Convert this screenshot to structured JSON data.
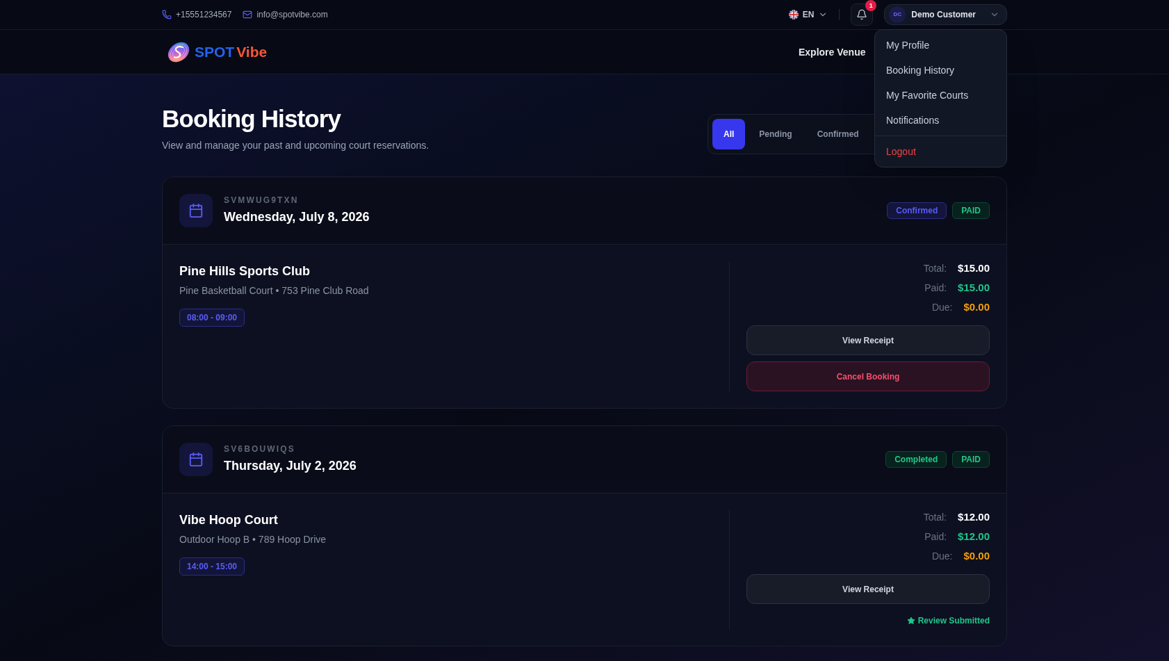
{
  "top_bar": {
    "phone": "+15551234567",
    "email": "info@spotvibe.com",
    "language": "EN",
    "notification_count": "1",
    "user": {
      "initials": "DC",
      "name": "Demo Customer",
      "menu_open": true
    }
  },
  "user_menu": [
    {
      "label": "My Profile",
      "kind": "item"
    },
    {
      "label": "Booking History",
      "kind": "item"
    },
    {
      "label": "My Favorite Courts",
      "kind": "item"
    },
    {
      "label": "Notifications",
      "kind": "item"
    },
    {
      "label": "Logout",
      "kind": "danger"
    }
  ],
  "logo": {
    "primary": "SPOT",
    "accent": "Vibe"
  },
  "nav_links": [
    "Explore Venue"
  ],
  "page": {
    "title": "Booking History",
    "subtitle": "View and manage your past and upcoming court reservations."
  },
  "filter_tabs": [
    {
      "label": "All",
      "selected": true
    },
    {
      "label": "Pending",
      "selected": false
    },
    {
      "label": "Confirmed",
      "selected": false
    }
  ],
  "bookings": [
    {
      "code": "SVMWUG9TXN",
      "date": "Wednesday, July 8, 2026",
      "status": {
        "label": "Confirmed",
        "kind": "confirmed"
      },
      "payment": {
        "label": "PAID",
        "kind": "paid"
      },
      "venue": "Pine Hills Sports Club",
      "details": "Pine Basketball Court • 753 Pine Club Road",
      "time": "08:00 - 09:00",
      "amounts": [
        {
          "label": "Total:",
          "value": "$15.00",
          "kind": "total"
        },
        {
          "label": "Paid:",
          "value": "$15.00",
          "kind": "paid"
        },
        {
          "label": "Due:",
          "value": "$0.00",
          "kind": "due"
        }
      ],
      "actions": [
        {
          "label": "View Receipt",
          "kind": "secondary"
        },
        {
          "label": "Cancel Booking",
          "kind": "danger"
        }
      ]
    },
    {
      "code": "SV6BOUWIQS",
      "date": "Thursday, July 2, 2026",
      "status": {
        "label": "Completed",
        "kind": "completed"
      },
      "payment": {
        "label": "PAID",
        "kind": "paid"
      },
      "venue": "Vibe Hoop Court",
      "details": "Outdoor Hoop B • 789 Hoop Drive",
      "time": "14:00 - 15:00",
      "amounts": [
        {
          "label": "Total:",
          "value": "$12.00",
          "kind": "total"
        },
        {
          "label": "Paid:",
          "value": "$12.00",
          "kind": "paid"
        },
        {
          "label": "Due:",
          "value": "$0.00",
          "kind": "due"
        }
      ],
      "actions": [
        {
          "label": "View Receipt",
          "kind": "secondary"
        }
      ],
      "review": {
        "label": "Review Submitted"
      }
    }
  ]
}
